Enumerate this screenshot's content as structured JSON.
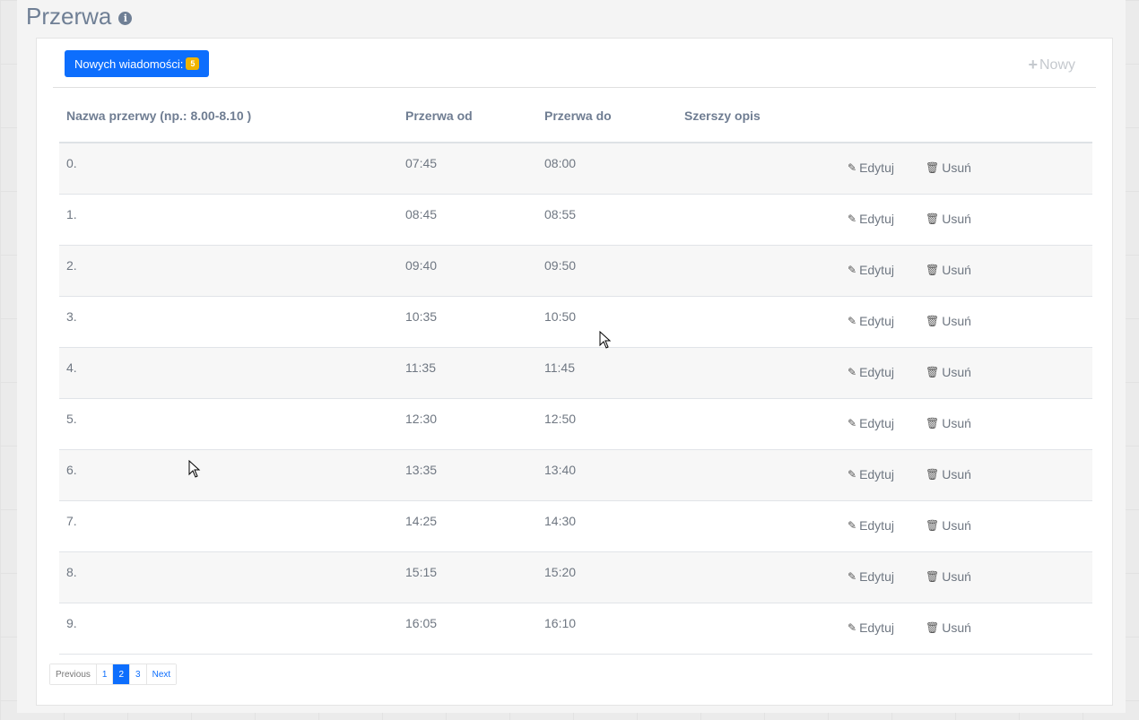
{
  "page": {
    "title": "Przerwa",
    "info_icon": "info-icon"
  },
  "toolbar": {
    "messages_label": "Nowych wiadomości:",
    "messages_count": "5",
    "new_label": "Nowy",
    "new_icon": "plus-icon"
  },
  "table": {
    "headers": {
      "name": "Nazwa przerwy (np.: 8.00-8.10 )",
      "from": "Przerwa od",
      "to": "Przerwa do",
      "desc": "Szerszy opis"
    },
    "edit_label": "Edytuj",
    "delete_label": "Usuń",
    "rows": [
      {
        "name": "0.",
        "from": "07:45",
        "to": "08:00",
        "desc": ""
      },
      {
        "name": "1.",
        "from": "08:45",
        "to": "08:55",
        "desc": ""
      },
      {
        "name": "2.",
        "from": "09:40",
        "to": "09:50",
        "desc": ""
      },
      {
        "name": "3.",
        "from": "10:35",
        "to": "10:50",
        "desc": ""
      },
      {
        "name": "4.",
        "from": "11:35",
        "to": "11:45",
        "desc": ""
      },
      {
        "name": "5.",
        "from": "12:30",
        "to": "12:50",
        "desc": ""
      },
      {
        "name": "6.",
        "from": "13:35",
        "to": "13:40",
        "desc": ""
      },
      {
        "name": "7.",
        "from": "14:25",
        "to": "14:30",
        "desc": ""
      },
      {
        "name": "8.",
        "from": "15:15",
        "to": "15:20",
        "desc": ""
      },
      {
        "name": "9.",
        "from": "16:05",
        "to": "16:10",
        "desc": ""
      }
    ]
  },
  "pagination": {
    "previous": "Previous",
    "pages": [
      "1",
      "2",
      "3"
    ],
    "active": "2",
    "next": "Next"
  },
  "colors": {
    "primary": "#0d6efd",
    "badge": "#f0b400",
    "title": "#6f7f95"
  }
}
